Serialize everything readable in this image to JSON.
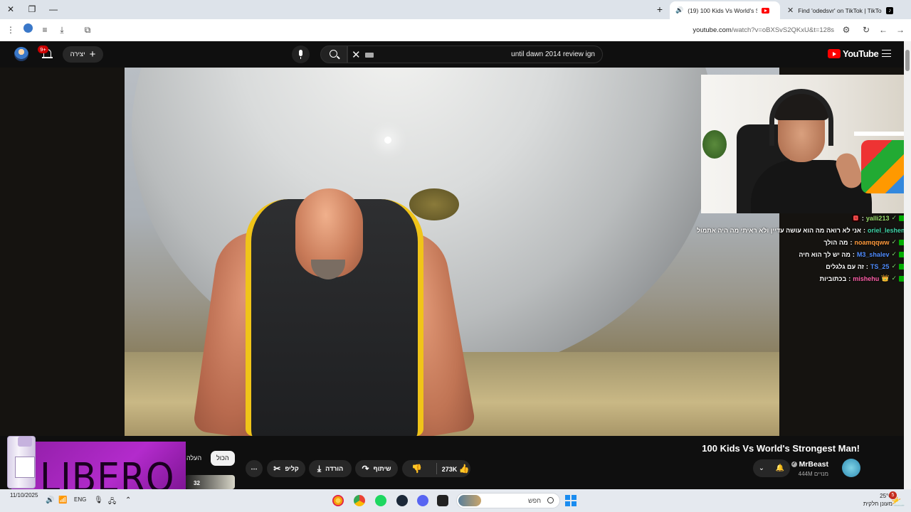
{
  "browser": {
    "tabs": [
      {
        "title": "(19) 100 Kids Vs World's Str",
        "icon": "youtube-icon",
        "active": true
      },
      {
        "title": "Find 'odedsvr' on TikTok | TikTo",
        "icon": "tiktok-icon",
        "active": false
      }
    ],
    "url": {
      "domain": "youtube.com",
      "path": "/watch?v=oBXSvS2QKxU&t=128s"
    }
  },
  "youtube": {
    "logo_text": "YouTube",
    "search_query": "until dawn 2014 review ign",
    "create_label": "יצירה",
    "notification_count": "9+",
    "video_title": "100 Kids Vs World's Strongest Man!",
    "channel_name": "MrBeast",
    "subscribers": "444M מנויים",
    "like_count": "273K",
    "share_label": "שיתוף",
    "download_label": "הורדה",
    "clip_label": "קליפ",
    "more_label": "⋯",
    "filter_chips": [
      "הכול",
      "העלה"
    ],
    "thumb_preview_text": "32"
  },
  "stream_overlay": {
    "chat": [
      {
        "user": "yalli213",
        "message": "🅽",
        "color": "#9adf6c"
      },
      {
        "user": "oriel_leshem",
        "message": "אני לא רואה מה הוא עושה עדיין ולא ראיתי מה היה אתמול",
        "color": "#3fd4a8"
      },
      {
        "user": "noamqqww",
        "message": "מה הולך",
        "color": "#ff9a3c"
      },
      {
        "user": "M3_shalev",
        "message": "מה יש לך הוא חיה",
        "color": "#4f8cff"
      },
      {
        "user": "TS_25",
        "message": "זה עם גלגלים",
        "color": "#4f8cff"
      },
      {
        "user": "mishehu",
        "message": "בכתוביות",
        "color": "#ff5fa8"
      }
    ]
  },
  "ad": {
    "brand": "LIBERO"
  },
  "taskbar": {
    "date": "11/10/2025",
    "language": "ENG",
    "search_placeholder": "חפש",
    "weather_temp": "25°C",
    "weather_desc": "מעונן חלקית",
    "weather_badge": "5"
  },
  "colors": {
    "accent": "#ff0000",
    "background": "#0f0f0f",
    "chip_active": "#f1f1f1"
  }
}
